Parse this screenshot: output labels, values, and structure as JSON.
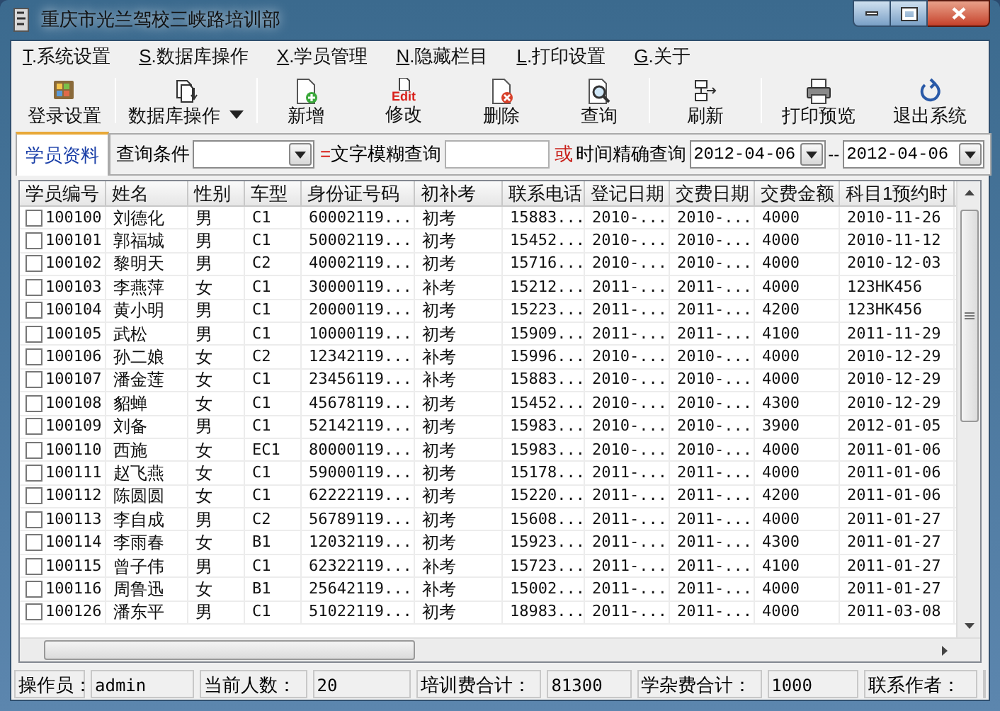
{
  "window": {
    "title": "重庆市光兰驾校三峡路培训部"
  },
  "menu": [
    {
      "label": "T.系统设置"
    },
    {
      "label": "S.数据库操作"
    },
    {
      "label": "X.学员管理"
    },
    {
      "label": "N.隐藏栏目"
    },
    {
      "label": "L.打印设置"
    },
    {
      "label": "G.关于"
    }
  ],
  "toolbar": [
    {
      "label": "登录设置",
      "kind": "login"
    },
    {
      "label": "数据库操作",
      "kind": "database",
      "dropdown": true
    },
    {
      "label": "新增",
      "kind": "add"
    },
    {
      "label": "修改",
      "kind": "edit",
      "icon_text": "Edit"
    },
    {
      "label": "删除",
      "kind": "delete"
    },
    {
      "label": "查询",
      "kind": "search"
    },
    {
      "label": "刷新",
      "kind": "refresh"
    },
    {
      "label": "打印预览",
      "kind": "print"
    },
    {
      "label": "退出系统",
      "kind": "exit"
    }
  ],
  "tabs": [
    {
      "label": "学员资料",
      "selected": true
    }
  ],
  "query": {
    "condition_label": "查询条件",
    "operator": "=",
    "fuzzy_label": "文字模糊查询",
    "or_label": "或",
    "exact_label": "时间精确查询",
    "date_from": "2012-04-06",
    "separator": "--",
    "date_to": "2012-04-06"
  },
  "table": {
    "columns": [
      "学员编号",
      "姓名",
      "性别",
      "车型",
      "身份证号码",
      "初补考",
      "联系电话",
      "登记日期",
      "交费日期",
      "交费金额",
      "科目1预约时"
    ],
    "rows": [
      {
        "checked": false,
        "cells": [
          "100100",
          "刘德化",
          "男",
          "C1",
          "60002119...",
          "初考",
          "15883...",
          "2010-...",
          "2010-...",
          "4000",
          "2010-11-26"
        ]
      },
      {
        "checked": false,
        "cells": [
          "100101",
          "郭福城",
          "男",
          "C1",
          "50002119...",
          "初考",
          "15452...",
          "2010-...",
          "2010-...",
          "4000",
          "2010-11-12"
        ]
      },
      {
        "checked": false,
        "cells": [
          "100102",
          "黎明天",
          "男",
          "C2",
          "40002119...",
          "初考",
          "15716...",
          "2010-...",
          "2010-...",
          "4000",
          "2010-12-03"
        ]
      },
      {
        "checked": false,
        "cells": [
          "100103",
          "李燕萍",
          "女",
          "C1",
          "30000119...",
          "补考",
          "15212...",
          "2011-...",
          "2011-...",
          "4000",
          "123HK456"
        ]
      },
      {
        "checked": false,
        "cells": [
          "100104",
          "黄小明",
          "男",
          "C1",
          "20000119...",
          "初考",
          "15223...",
          "2011-...",
          "2011-...",
          "4200",
          "123HK456"
        ]
      },
      {
        "checked": false,
        "cells": [
          "100105",
          "武松",
          "男",
          "C1",
          "10000119...",
          "初考",
          "15909...",
          "2011-...",
          "2011-...",
          "4100",
          "2011-11-29"
        ]
      },
      {
        "checked": false,
        "cells": [
          "100106",
          "孙二娘",
          "女",
          "C2",
          "12342119...",
          "补考",
          "15996...",
          "2010-...",
          "2010-...",
          "4000",
          "2010-12-29"
        ]
      },
      {
        "checked": false,
        "cells": [
          "100107",
          "潘金莲",
          "女",
          "C1",
          "23456119...",
          "补考",
          "15883...",
          "2010-...",
          "2010-...",
          "4000",
          "2010-12-29"
        ]
      },
      {
        "checked": false,
        "cells": [
          "100108",
          "貂蝉",
          "女",
          "C1",
          "45678119...",
          "初考",
          "15452...",
          "2010-...",
          "2010-...",
          "4300",
          "2010-12-29"
        ]
      },
      {
        "checked": false,
        "cells": [
          "100109",
          "刘备",
          "男",
          "C1",
          "52142119...",
          "初考",
          "15983...",
          "2010-...",
          "2010-...",
          "3900",
          "2012-01-05"
        ]
      },
      {
        "checked": false,
        "cells": [
          "100110",
          "西施",
          "女",
          "EC1",
          "80000119...",
          "初考",
          "15983...",
          "2010-...",
          "2010-...",
          "4000",
          "2011-01-06"
        ]
      },
      {
        "checked": false,
        "cells": [
          "100111",
          "赵飞燕",
          "女",
          "C1",
          "59000119...",
          "初考",
          "15178...",
          "2011-...",
          "2011-...",
          "4000",
          "2011-01-06"
        ]
      },
      {
        "checked": false,
        "cells": [
          "100112",
          "陈圆圆",
          "女",
          "C1",
          "62222119...",
          "初考",
          "15220...",
          "2011-...",
          "2011-...",
          "4200",
          "2011-01-06"
        ]
      },
      {
        "checked": false,
        "cells": [
          "100113",
          "李自成",
          "男",
          "C2",
          "56789119...",
          "初考",
          "15608...",
          "2011-...",
          "2011-...",
          "4000",
          "2011-01-27"
        ]
      },
      {
        "checked": false,
        "cells": [
          "100114",
          "李雨春",
          "女",
          "B1",
          "12032119...",
          "初考",
          "15923...",
          "2011-...",
          "2011-...",
          "4300",
          "2011-01-27"
        ]
      },
      {
        "checked": false,
        "cells": [
          "100115",
          "曾子伟",
          "男",
          "C1",
          "62322119...",
          "补考",
          "15723...",
          "2011-...",
          "2011-...",
          "4100",
          "2011-01-27"
        ]
      },
      {
        "checked": false,
        "cells": [
          "100116",
          "周鲁迅",
          "女",
          "B1",
          "25642119...",
          "补考",
          "15002...",
          "2011-...",
          "2011-...",
          "4000",
          "2011-01-27"
        ]
      },
      {
        "checked": false,
        "cells": [
          "100126",
          "潘东平",
          "男",
          "C1",
          "51022119...",
          "初考",
          "18983...",
          "2011-...",
          "2011-...",
          "4000",
          "2011-03-08"
        ]
      }
    ]
  },
  "status_bar": [
    {
      "label": "操作员：",
      "value": "admin"
    },
    {
      "label": "当前人数：",
      "value": "20"
    },
    {
      "label": "培训费合计：",
      "value": "81300"
    },
    {
      "label": "学杂费合计：",
      "value": "1000"
    },
    {
      "label": "联系作者："
    }
  ]
}
